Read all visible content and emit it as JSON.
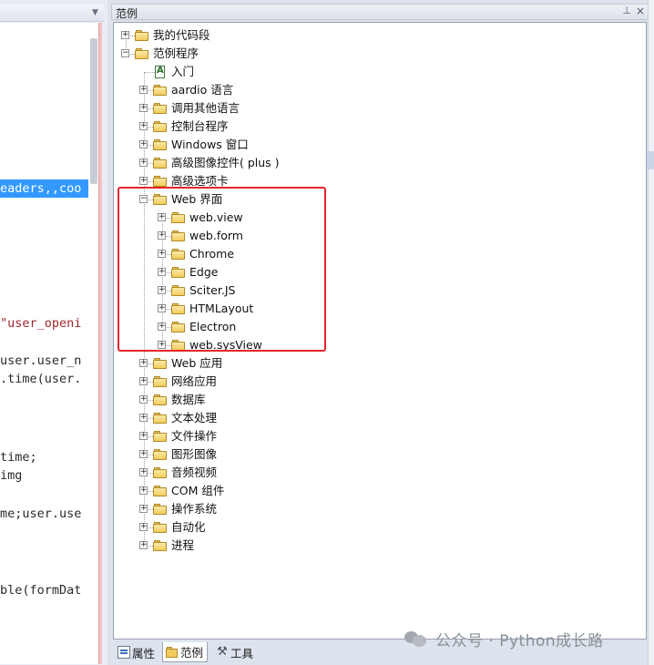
{
  "editor": {
    "lines": [
      {
        "text": "eaders,,coo",
        "selected": true
      },
      {
        "text": "\"user_openi",
        "selected": false,
        "string": true
      },
      {
        "text": "user.user_n",
        "selected": false
      },
      {
        "text": ".time(user.",
        "selected": false
      },
      {
        "text": "time;",
        "selected": false
      },
      {
        "text": "img",
        "selected": false
      },
      {
        "text": "me;user.use",
        "selected": false
      },
      {
        "text": "ble(formDat",
        "selected": false
      }
    ]
  },
  "panel": {
    "title": "范例",
    "pin_icon": "pin-icon",
    "close_icon": "close-icon"
  },
  "tree": {
    "nodes": [
      {
        "label": "我的代码段",
        "level": 0,
        "expander": "+",
        "icon": "folder-icon"
      },
      {
        "label": "范例程序",
        "level": 0,
        "expander": "-",
        "icon": "folder-icon"
      },
      {
        "label": "入门",
        "level": 1,
        "expander": "",
        "icon": "document-icon"
      },
      {
        "label": "aardio 语言",
        "level": 1,
        "expander": "+",
        "icon": "folder-icon"
      },
      {
        "label": "调用其他语言",
        "level": 1,
        "expander": "+",
        "icon": "folder-icon"
      },
      {
        "label": "控制台程序",
        "level": 1,
        "expander": "+",
        "icon": "folder-icon"
      },
      {
        "label": "Windows 窗口",
        "level": 1,
        "expander": "+",
        "icon": "folder-icon"
      },
      {
        "label": "高级图像控件( plus )",
        "level": 1,
        "expander": "+",
        "icon": "folder-icon"
      },
      {
        "label": "高级选项卡",
        "level": 1,
        "expander": "+",
        "icon": "folder-icon"
      },
      {
        "label": "Web 界面",
        "level": 1,
        "expander": "-",
        "icon": "folder-icon"
      },
      {
        "label": "web.view",
        "level": 2,
        "expander": "+",
        "icon": "folder-icon"
      },
      {
        "label": "web.form",
        "level": 2,
        "expander": "+",
        "icon": "folder-icon"
      },
      {
        "label": "Chrome",
        "level": 2,
        "expander": "+",
        "icon": "folder-icon"
      },
      {
        "label": "Edge",
        "level": 2,
        "expander": "+",
        "icon": "folder-icon"
      },
      {
        "label": "Sciter.JS",
        "level": 2,
        "expander": "+",
        "icon": "folder-icon"
      },
      {
        "label": "HTMLayout",
        "level": 2,
        "expander": "+",
        "icon": "folder-icon"
      },
      {
        "label": "Electron",
        "level": 2,
        "expander": "+",
        "icon": "folder-icon"
      },
      {
        "label": "web.sysView",
        "level": 2,
        "expander": "+",
        "icon": "folder-icon"
      },
      {
        "label": "Web 应用",
        "level": 1,
        "expander": "+",
        "icon": "folder-icon"
      },
      {
        "label": "网络应用",
        "level": 1,
        "expander": "+",
        "icon": "folder-icon"
      },
      {
        "label": "数据库",
        "level": 1,
        "expander": "+",
        "icon": "folder-open-icon"
      },
      {
        "label": "文本处理",
        "level": 1,
        "expander": "+",
        "icon": "folder-icon"
      },
      {
        "label": "文件操作",
        "level": 1,
        "expander": "+",
        "icon": "folder-icon"
      },
      {
        "label": "图形图像",
        "level": 1,
        "expander": "+",
        "icon": "folder-icon"
      },
      {
        "label": "音频视频",
        "level": 1,
        "expander": "+",
        "icon": "folder-icon"
      },
      {
        "label": "COM 组件",
        "level": 1,
        "expander": "+",
        "icon": "folder-icon"
      },
      {
        "label": "操作系统",
        "level": 1,
        "expander": "+",
        "icon": "folder-icon"
      },
      {
        "label": "自动化",
        "level": 1,
        "expander": "+",
        "icon": "folder-icon"
      },
      {
        "label": "进程",
        "level": 1,
        "expander": "+",
        "icon": "folder-icon"
      }
    ]
  },
  "bottom_tabs": [
    {
      "label": "属性",
      "icon": "properties-icon",
      "active": false
    },
    {
      "label": "范例",
      "icon": "examples-icon",
      "active": true
    },
    {
      "label": "工具",
      "icon": "tools-icon",
      "active": false
    }
  ],
  "watermark": {
    "text": "公众号 · Python成长路"
  },
  "colors": {
    "selection": "#3399ff",
    "highlight_box": "#e8242a",
    "folder": "#f2cc5e"
  }
}
